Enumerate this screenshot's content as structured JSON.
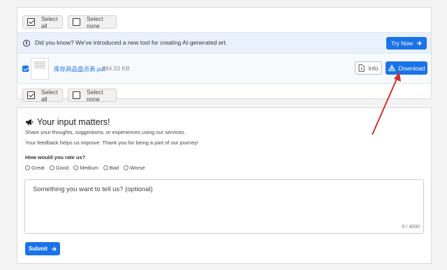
{
  "selection_bar": {
    "select_all": "Select all",
    "select_none": "Select none"
  },
  "notice": {
    "text": "Did you know? We've introduced a new tool for creating AI-generated art.",
    "button": "Try Now"
  },
  "file": {
    "name": "库存商品盘点表.pdf",
    "size": "284.33 KB",
    "info_button": "Info",
    "download_button": "Download"
  },
  "feedback": {
    "title": "Your input matters!",
    "line1": "Share your thoughts, suggestions, or experiences using our services.",
    "line2": "Your feedback helps us improve. Thank you for being a part of our journey!",
    "question": "How would you rate us?",
    "options": [
      "Great",
      "Good",
      "Medium",
      "Bad",
      "Worse"
    ],
    "textarea_placeholder": "Something you want to tell us? (optional)",
    "char_count": "0 / 4000",
    "submit": "Submit"
  },
  "colors": {
    "primary": "#1a73e8",
    "annotation": "#d32f2f",
    "notice_bg": "#e8f1fc"
  }
}
